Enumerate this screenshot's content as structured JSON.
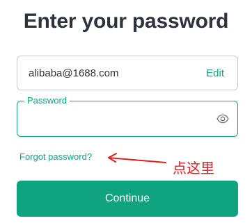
{
  "header": {
    "title": "Enter your password"
  },
  "email": {
    "value": "alibaba@1688.com",
    "edit_label": "Edit"
  },
  "password": {
    "label": "Password",
    "value": "",
    "toggle_icon": "eye-icon"
  },
  "links": {
    "forgot_password": "Forgot password?"
  },
  "annotation": {
    "text": "点这里",
    "color": "#e02020"
  },
  "actions": {
    "continue_label": "Continue"
  },
  "colors": {
    "accent": "#10a37f",
    "text": "#2d333a",
    "border": "#c2c8d0"
  }
}
